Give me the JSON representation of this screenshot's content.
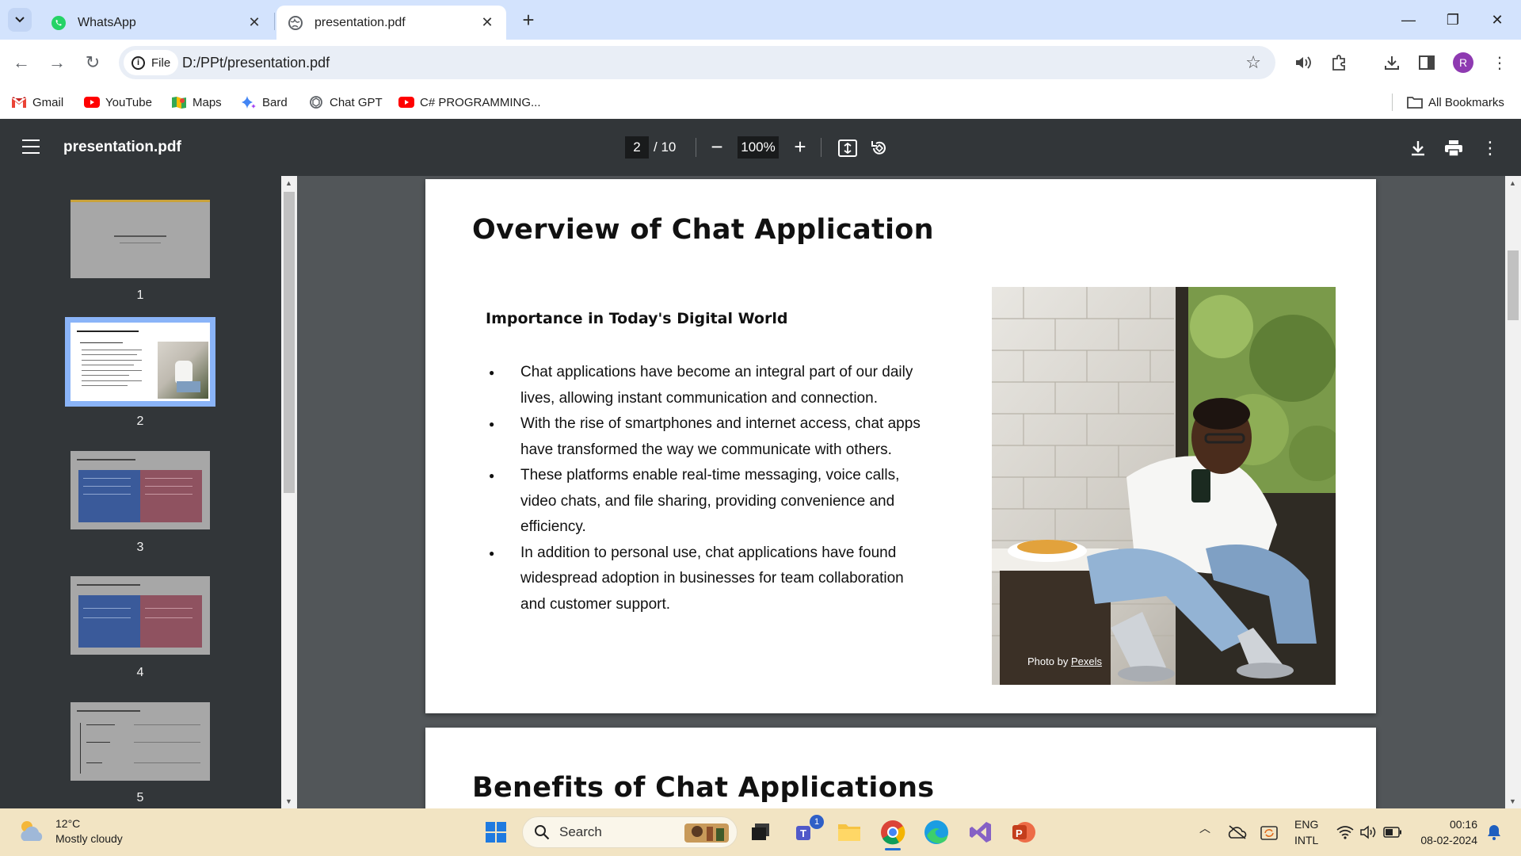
{
  "browser": {
    "tabs": [
      {
        "title": "WhatsApp",
        "active": false,
        "icon": "whatsapp-icon"
      },
      {
        "title": "presentation.pdf",
        "active": true,
        "icon": "globe-icon"
      }
    ],
    "address": {
      "scheme_chip": "File",
      "url": "D:/PPt/presentation.pdf"
    },
    "bookmarks": [
      {
        "label": "Gmail",
        "icon": "gmail-icon"
      },
      {
        "label": "YouTube",
        "icon": "youtube-icon"
      },
      {
        "label": "Maps",
        "icon": "maps-icon"
      },
      {
        "label": "Bard",
        "icon": "bard-icon"
      },
      {
        "label": "Chat GPT",
        "icon": "chatgpt-icon"
      },
      {
        "label": "C# PROGRAMMING...",
        "icon": "youtube-icon"
      }
    ],
    "all_bookmarks": "All Bookmarks",
    "profile_initial": "R"
  },
  "pdf": {
    "filename": "presentation.pdf",
    "current_page": "2",
    "total_pages": "/ 10",
    "zoom": "100%"
  },
  "thumbnails": [
    {
      "number": "1",
      "selected": false
    },
    {
      "number": "2",
      "selected": true
    },
    {
      "number": "3",
      "selected": false
    },
    {
      "number": "4",
      "selected": false
    },
    {
      "number": "5",
      "selected": false
    }
  ],
  "slide2": {
    "title": "Overview of Chat Application",
    "subheading": "Importance in Today's Digital World",
    "bullets": [
      "Chat applications have become an integral part of our daily lives, allowing instant communication and connection.",
      "With the rise of smartphones and internet access, chat apps have transformed the way we communicate with others.",
      "These platforms enable real-time messaging, voice calls, video chats, and file sharing, providing convenience and efficiency.",
      "In addition to personal use, chat applications have found widespread adoption in businesses for team collaboration and customer support."
    ],
    "photo_credit_prefix": "Photo by",
    "photo_credit_link": "Pexels"
  },
  "slide3": {
    "title": "Benefits of Chat Applications"
  },
  "taskbar": {
    "temperature": "12°C",
    "weather": "Mostly cloudy",
    "search_placeholder": "Search",
    "teams_badge": "1",
    "lang_1": "ENG",
    "lang_2": "INTL",
    "time": "00:16",
    "date": "08-02-2024"
  },
  "colors": {
    "tabstrip": "#d3e3fd",
    "pdf_toolbar": "#323639",
    "pdf_background": "#525659",
    "thumb_selected": "#8ab4f8",
    "taskbar": "#f2e4c3"
  }
}
